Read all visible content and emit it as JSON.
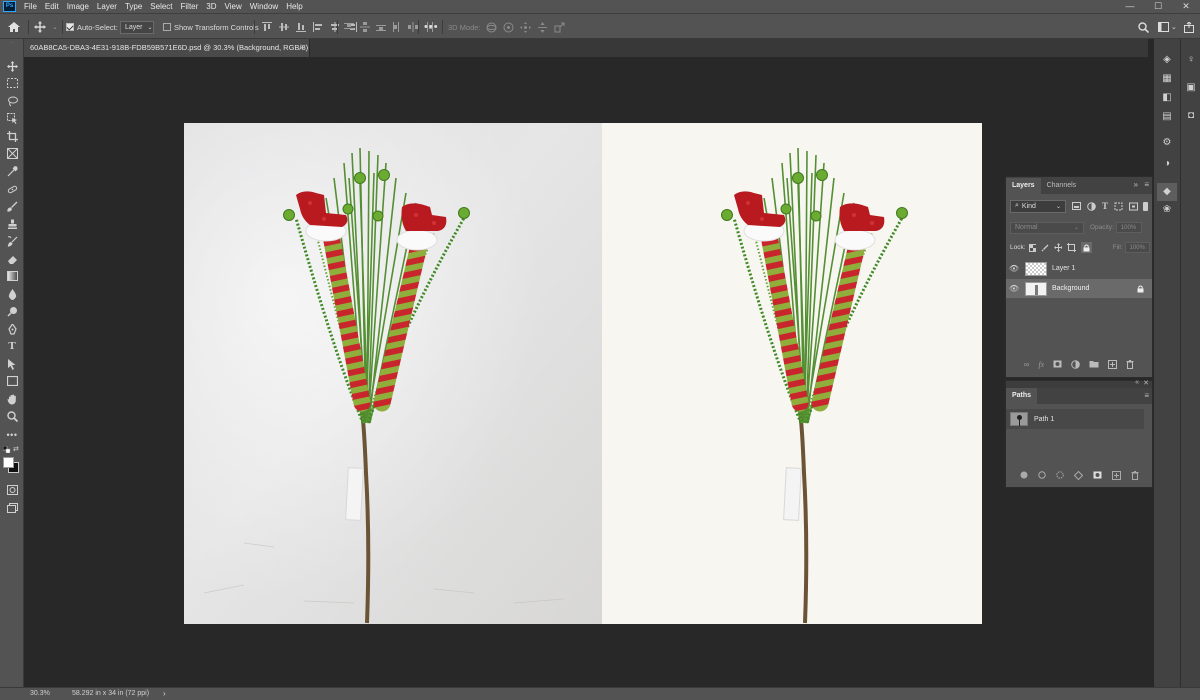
{
  "app": {
    "logo_label": "Ps"
  },
  "menu": [
    "File",
    "Edit",
    "Image",
    "Layer",
    "Type",
    "Select",
    "Filter",
    "3D",
    "View",
    "Window",
    "Help"
  ],
  "window_controls": {
    "minimize": "—",
    "maximize": "☐",
    "close": "✕"
  },
  "options": {
    "auto_select_label": "Auto-Select:",
    "auto_select_checked": true,
    "auto_select_target": "Layer",
    "show_transform_label": "Show Transform Controls",
    "show_transform_checked": false,
    "mode_3d_label": "3D Mode:"
  },
  "document_tab": {
    "title": "60AB8CA5-DBA3-4E31-918B-FDB59B571E6D.psd @ 30.3% (Background, RGB/8) *",
    "close": "×"
  },
  "layers_panel": {
    "tabs": [
      "Layers",
      "Channels"
    ],
    "kind_label": "Kind",
    "blend_mode": "Normal",
    "opacity_label": "Opacity:",
    "opacity_value": "100%",
    "lock_label": "Lock:",
    "fill_label": "Fill:",
    "fill_value": "100%",
    "layers": [
      {
        "name": "Layer 1",
        "visible": true,
        "locked": false
      },
      {
        "name": "Background",
        "visible": true,
        "locked": true
      }
    ]
  },
  "paths_panel": {
    "tabs": [
      "Paths"
    ],
    "paths": [
      {
        "name": "Path 1"
      }
    ]
  },
  "status": {
    "zoom": "30.3%",
    "doc_size": "58.292 in x 34 in (72 ppi)",
    "arrow": "›"
  },
  "colors": {
    "ui_dark": "#282828",
    "ui_panel": "#535353",
    "ps_blue": "#31a8ff",
    "berry_green": "#5fa52f",
    "boot_red": "#c8202a",
    "stocking_green": "#8aa83a",
    "stem_brown": "#6b5435"
  }
}
